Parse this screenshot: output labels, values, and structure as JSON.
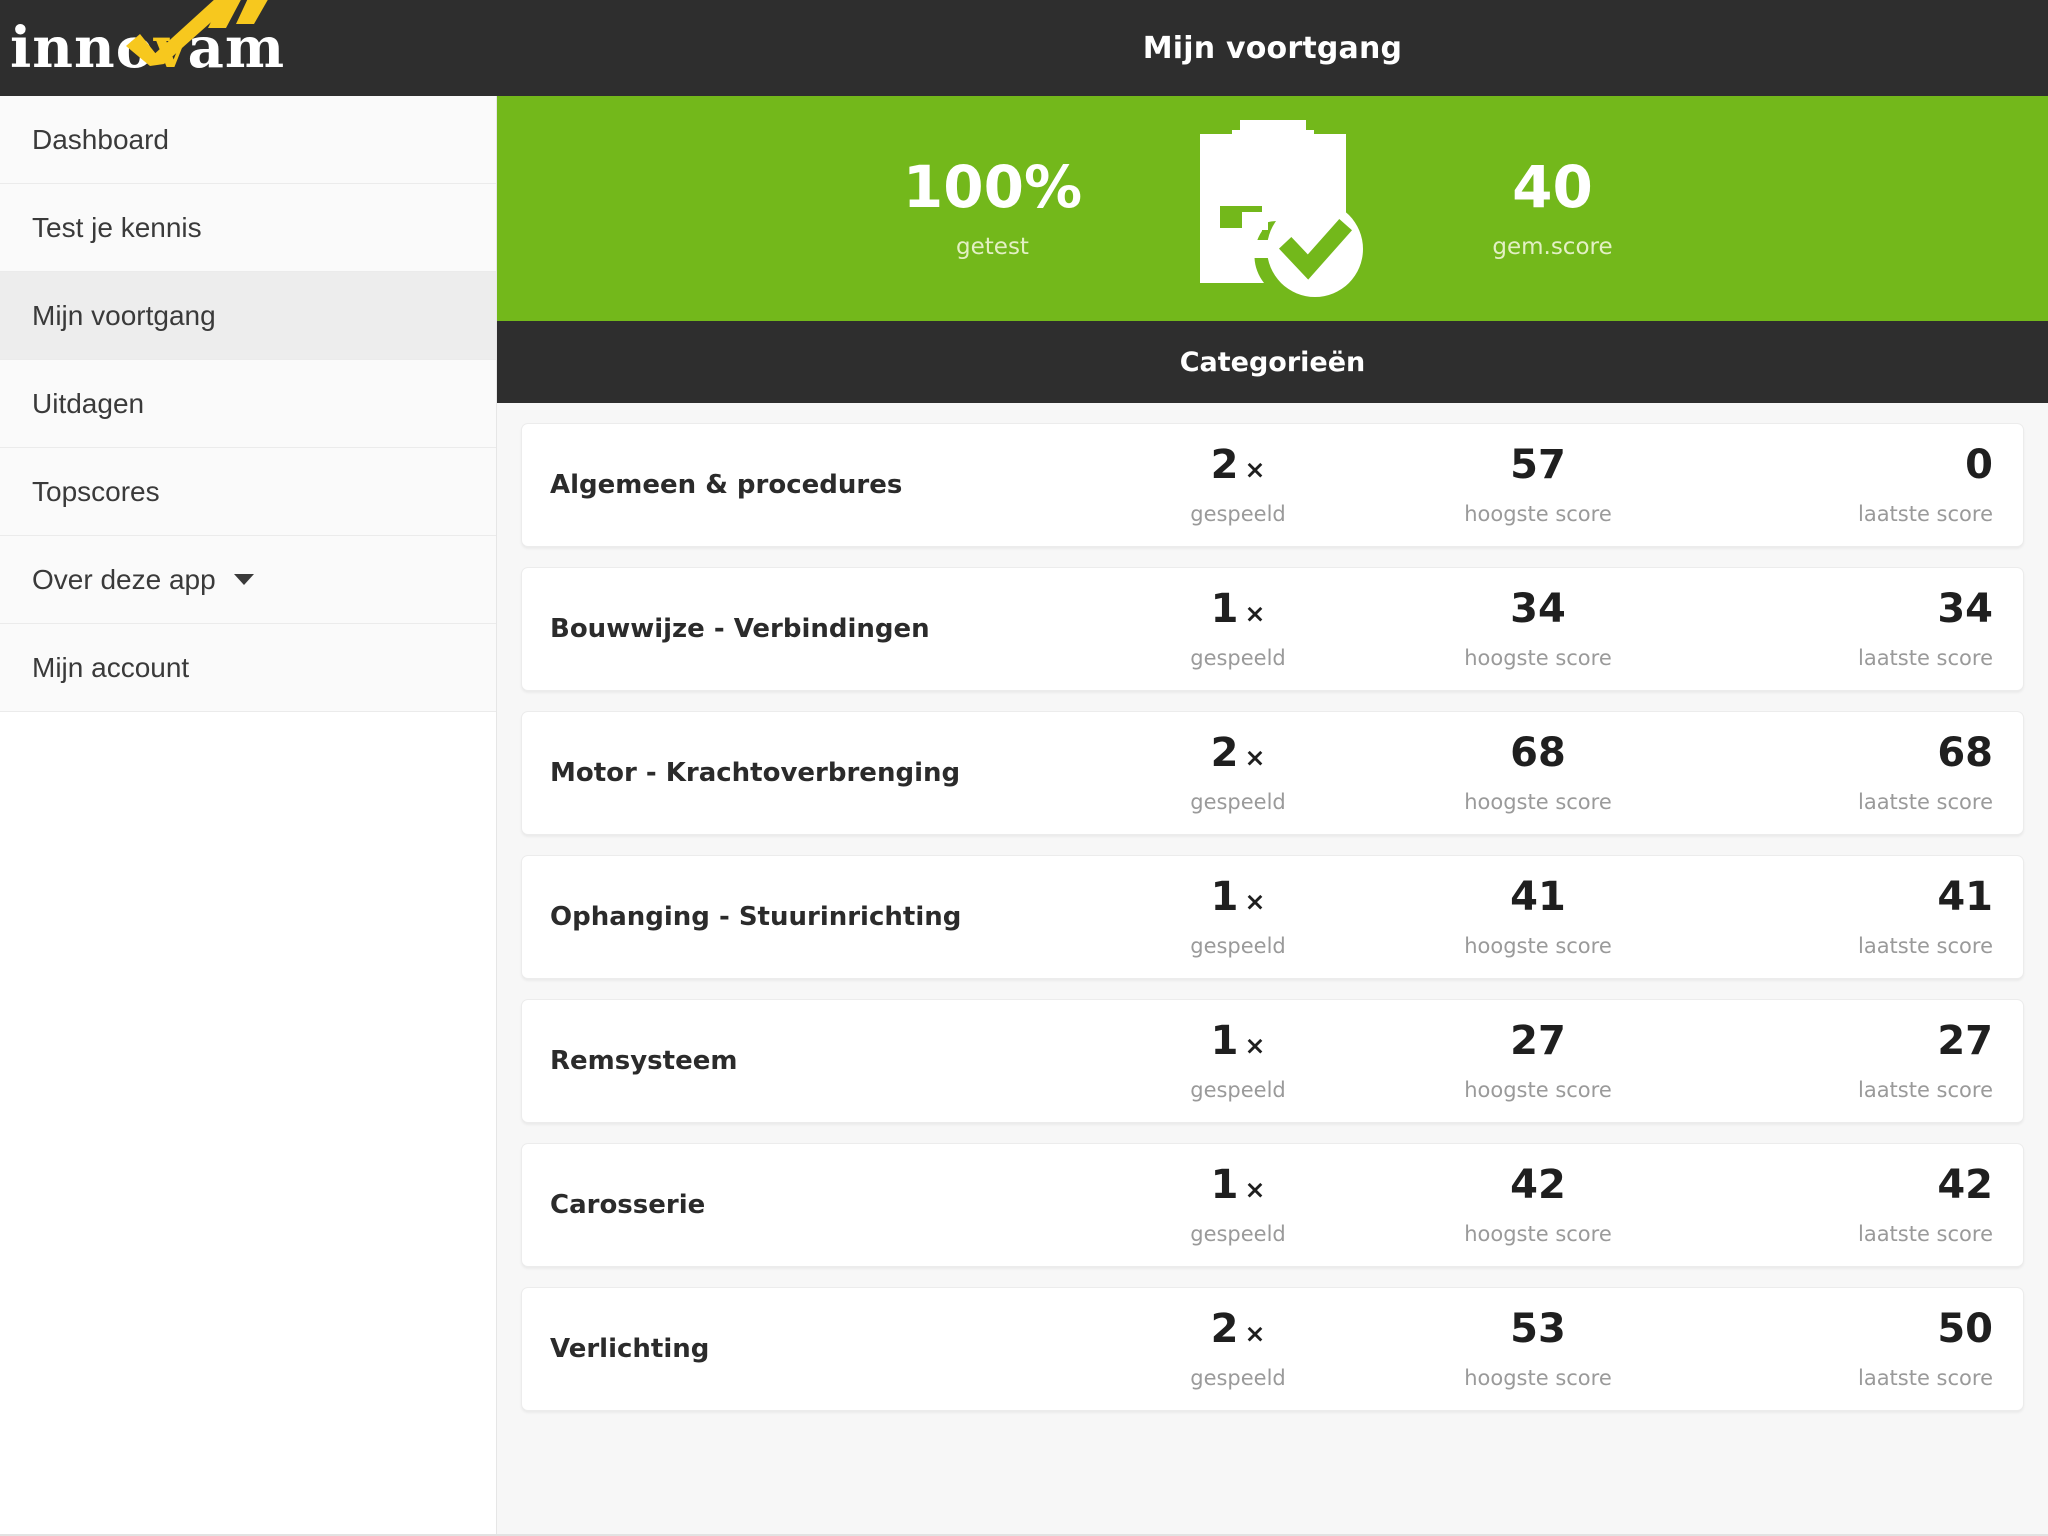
{
  "brand": {
    "name_prefix": "inno",
    "name_v": "v",
    "name_suffix": "am",
    "logo_icon": "innovam-checkmark-logo",
    "accent_yellow": "#f7c81e"
  },
  "header": {
    "title": "Mijn voortgang",
    "background": "#2e2e2e"
  },
  "sidebar": {
    "items": [
      {
        "label": "Dashboard",
        "active": false,
        "has_dropdown": false
      },
      {
        "label": "Test je kennis",
        "active": false,
        "has_dropdown": false
      },
      {
        "label": "Mijn voortgang",
        "active": true,
        "has_dropdown": false
      },
      {
        "label": "Uitdagen",
        "active": false,
        "has_dropdown": false
      },
      {
        "label": "Topscores",
        "active": false,
        "has_dropdown": false
      },
      {
        "label": "Over deze app",
        "active": false,
        "has_dropdown": true
      },
      {
        "label": "Mijn account",
        "active": false,
        "has_dropdown": false
      }
    ]
  },
  "stats": {
    "background": "#73b81b",
    "icon": "clipboard-check-icon",
    "left": {
      "value": "100%",
      "label": "getest"
    },
    "right": {
      "value": "40",
      "label": "gem.score"
    }
  },
  "categories_section": {
    "title": "Categorieën",
    "column_labels": {
      "played": "gespeeld",
      "highest": "hoogste score",
      "last": "laatste score"
    },
    "multiplier_symbol": "×",
    "rows": [
      {
        "name": "Algemeen & procedures",
        "played": "2",
        "highest": "57",
        "last": "0"
      },
      {
        "name": "Bouwwijze - Verbindingen",
        "played": "1",
        "highest": "34",
        "last": "34"
      },
      {
        "name": "Motor - Krachtoverbrenging",
        "played": "2",
        "highest": "68",
        "last": "68"
      },
      {
        "name": "Ophanging - Stuurinrichting",
        "played": "1",
        "highest": "41",
        "last": "41"
      },
      {
        "name": "Remsysteem",
        "played": "1",
        "highest": "27",
        "last": "27"
      },
      {
        "name": "Carosserie",
        "played": "1",
        "highest": "42",
        "last": "42"
      },
      {
        "name": "Verlichting",
        "played": "2",
        "highest": "53",
        "last": "50"
      }
    ]
  }
}
